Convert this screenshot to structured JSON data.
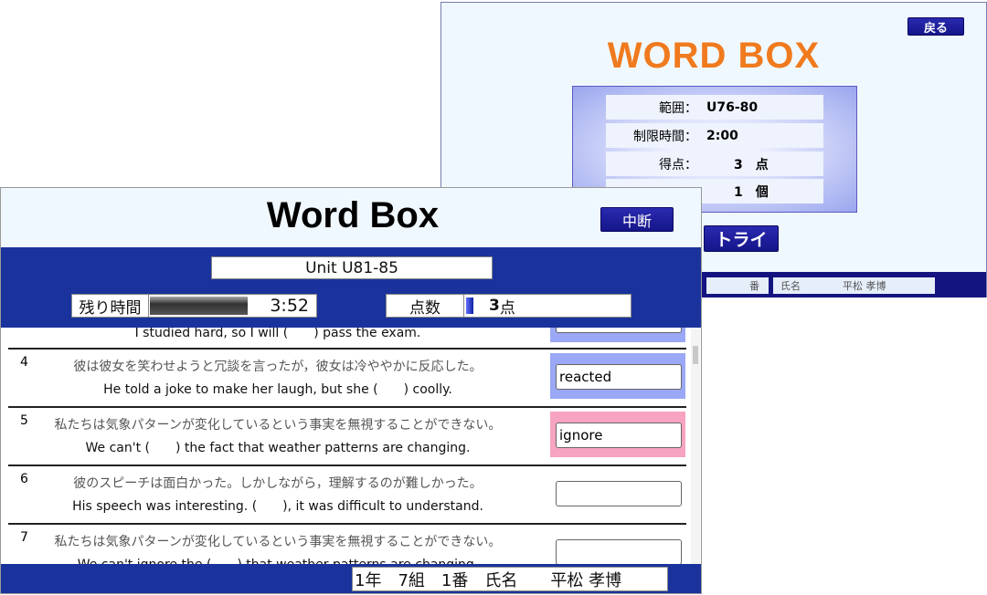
{
  "back_window": {
    "back_button": "戻る",
    "title": "WORD BOX",
    "summary": [
      {
        "label": "範囲：",
        "value": "U76-80"
      },
      {
        "label": "制限時間：",
        "value": "2:00"
      },
      {
        "label": "得点：",
        "value": "3　点"
      },
      {
        "label": "",
        "value": "1　個"
      }
    ],
    "retry_button": "トライ",
    "footer": {
      "number_label": "番",
      "name_label": "氏名",
      "name": "平松 孝博"
    }
  },
  "front_window": {
    "title": "Word Box",
    "pause_button": "中断",
    "unit": "Unit U81-85",
    "timer": {
      "label": "残り時間",
      "value": "3:52",
      "progress_percent": 75
    },
    "score": {
      "label": "点数",
      "value": "3",
      "unit": "点"
    },
    "questions": [
      {
        "num": "",
        "jp": "",
        "en": "I studied hard, so I will (　　) pass the exam.",
        "answer": "",
        "state": "correct"
      },
      {
        "num": "4",
        "jp": "彼は彼女を笑わせようと冗談を言ったが，彼女は冷ややかに反応した。",
        "en": "He told a joke to make her laugh, but she (　　) coolly.",
        "answer": "reacted",
        "state": "correct"
      },
      {
        "num": "5",
        "jp": "私たちは気象パターンが変化しているという事実を無視することができない。",
        "en": "We can't (　　) the fact that weather patterns are changing.",
        "answer": "ignore",
        "state": "active"
      },
      {
        "num": "6",
        "jp": "彼のスピーチは面白かった。しかしながら，理解するのが難しかった。",
        "en": "His speech was interesting. (　　), it was difficult to understand.",
        "answer": "",
        "state": "empty"
      },
      {
        "num": "7",
        "jp": "私たちは気象パターンが変化しているという事実を無視することができない。",
        "en": "We can't ignore the (　　) that weather patterns are changing.",
        "answer": "",
        "state": "empty"
      }
    ],
    "footer": {
      "student": "1年　7組　1番　氏名　　平松 孝博"
    }
  },
  "colors": {
    "navy": "#1a339c",
    "orange": "#f07a1e",
    "correct": "#9aa8f5",
    "active": "#f7a3c2"
  }
}
